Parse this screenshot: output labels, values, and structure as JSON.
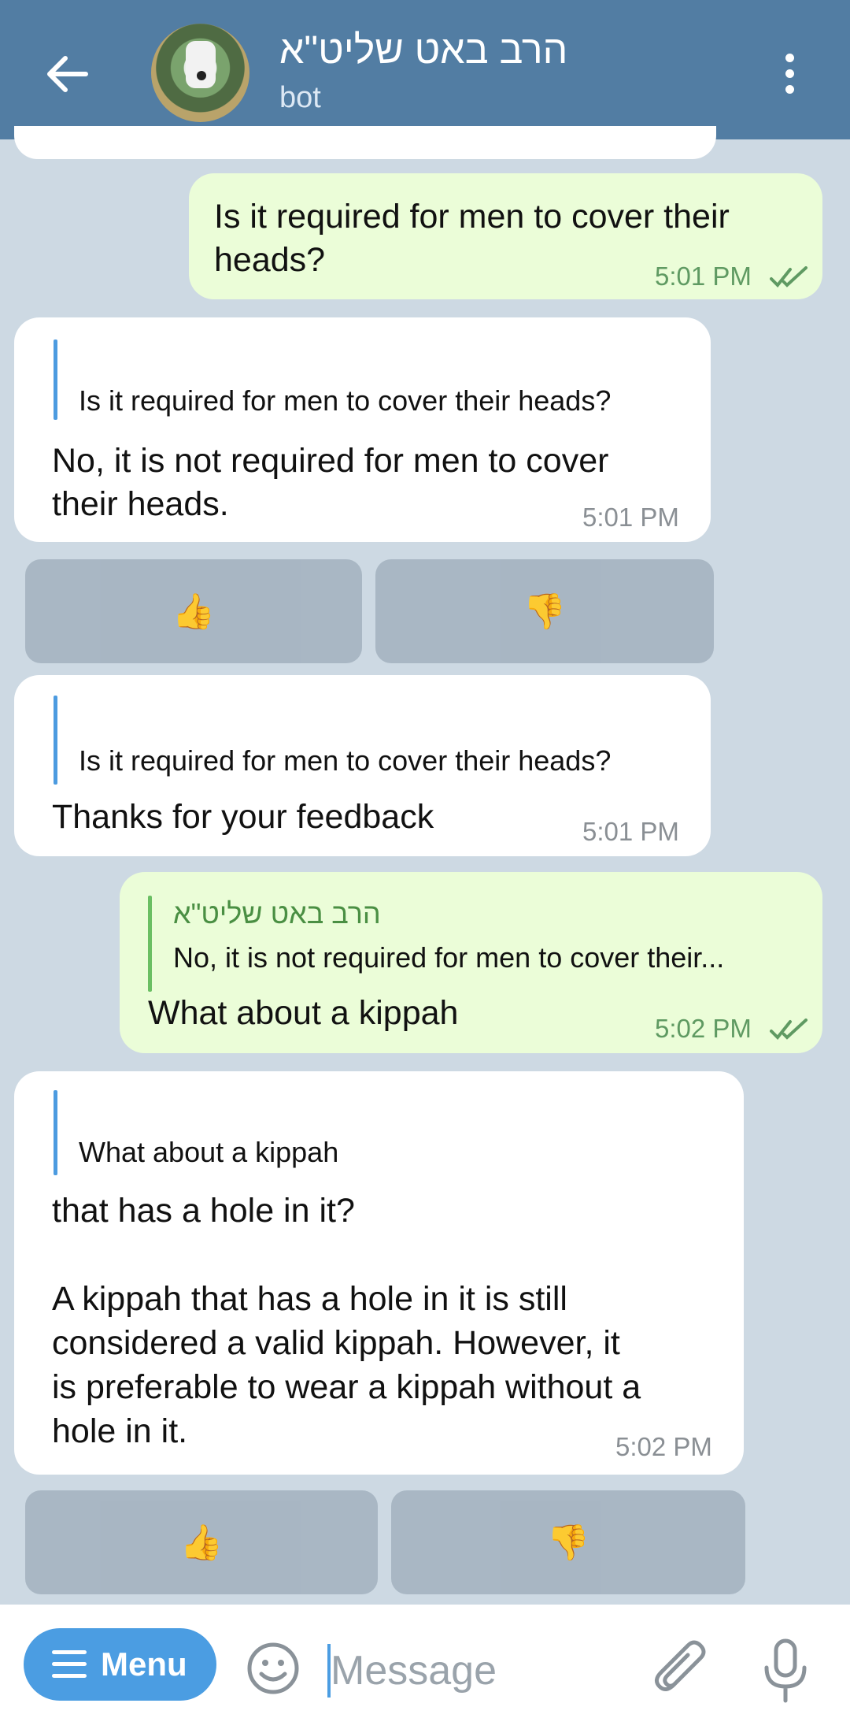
{
  "header": {
    "title": "הרב באט שליט\"א",
    "subtitle": "bot"
  },
  "messages": [
    {
      "text_lines": [
        "Is it required for men to cover their",
        "heads?"
      ],
      "time": "5:01 PM"
    },
    {
      "quote": "Is it required for men to cover their heads?",
      "text_lines": [
        "No, it is not required for men to cover",
        "their heads."
      ],
      "time": "5:01 PM"
    },
    {
      "quote": "Is it required for men to cover their heads?",
      "text_lines": [
        "Thanks for your feedback"
      ],
      "time": "5:01 PM"
    },
    {
      "quote_title": "הרב באט שליט\"א",
      "quote": "No, it is not required for men to cover their...",
      "text_lines": [
        "What about a kippah"
      ],
      "time": "5:02 PM"
    },
    {
      "quote": "What about a kippah",
      "text_lines": [
        "that has a hole in it?",
        "",
        "A kippah that has a hole in it is still",
        "considered a valid kippah. However, it",
        "is preferable to wear a kippah without a",
        "hole in it."
      ],
      "time": "5:02 PM"
    }
  ],
  "feedback_buttons": {
    "like": "👍",
    "dislike": "👎"
  },
  "bottom_bar": {
    "menu_label": "Menu",
    "message_placeholder": "Message"
  },
  "colors": {
    "header": "#527da3",
    "outgoing_bubble": "#ebfdd8",
    "incoming_bubble": "#ffffff",
    "accent": "#4b9de2"
  }
}
